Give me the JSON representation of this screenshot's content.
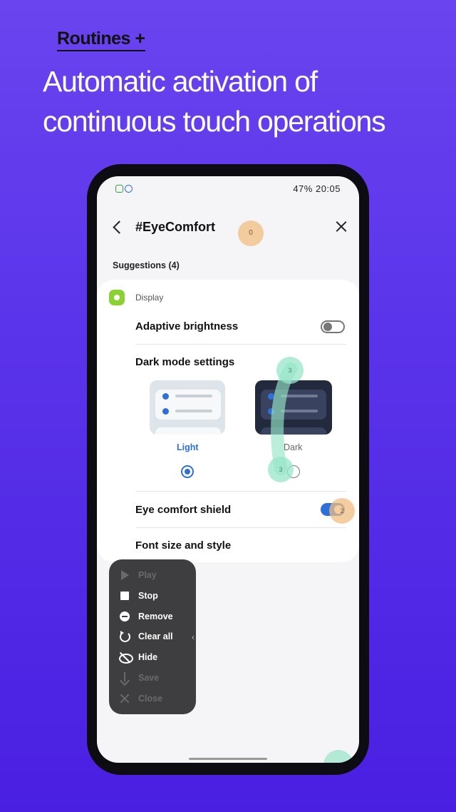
{
  "promo": {
    "tag": "Routines +",
    "title": "Automatic activation of continuous touch operations"
  },
  "status_bar": {
    "battery_time": "47% 20:05"
  },
  "header": {
    "title": "#EyeComfort"
  },
  "suggestions": {
    "label": "Suggestions (4)"
  },
  "card": {
    "category": "Display",
    "adaptive_brightness": {
      "label": "Adaptive brightness",
      "enabled": false
    },
    "dark_mode": {
      "label": "Dark mode settings",
      "options": [
        {
          "label": "Light",
          "selected": true
        },
        {
          "label": "Dark",
          "selected": false
        }
      ]
    },
    "eye_comfort_shield": {
      "label": "Eye comfort shield",
      "enabled": true
    },
    "font_size_style": {
      "label": "Font size and style"
    }
  },
  "touch_markers": [
    "0",
    "3",
    "3",
    "2"
  ],
  "toolbar": {
    "items": [
      {
        "label": "Play",
        "icon": "play-icon",
        "enabled": false
      },
      {
        "label": "Stop",
        "icon": "stop-icon",
        "enabled": true
      },
      {
        "label": "Remove",
        "icon": "remove-icon",
        "enabled": true
      },
      {
        "label": "Clear all",
        "icon": "clear-all-icon",
        "enabled": true
      },
      {
        "label": "Hide",
        "icon": "hide-icon",
        "enabled": true
      },
      {
        "label": "Save",
        "icon": "save-icon",
        "enabled": false
      },
      {
        "label": "Close",
        "icon": "close-icon",
        "enabled": false
      }
    ]
  },
  "colors": {
    "accent": "#2f6fd8",
    "background_gradient_top": "#6a44ee",
    "background_gradient_bottom": "#4a1fe2",
    "toolbar_bg": "#3e3e40",
    "display_icon": "#8bd134"
  }
}
